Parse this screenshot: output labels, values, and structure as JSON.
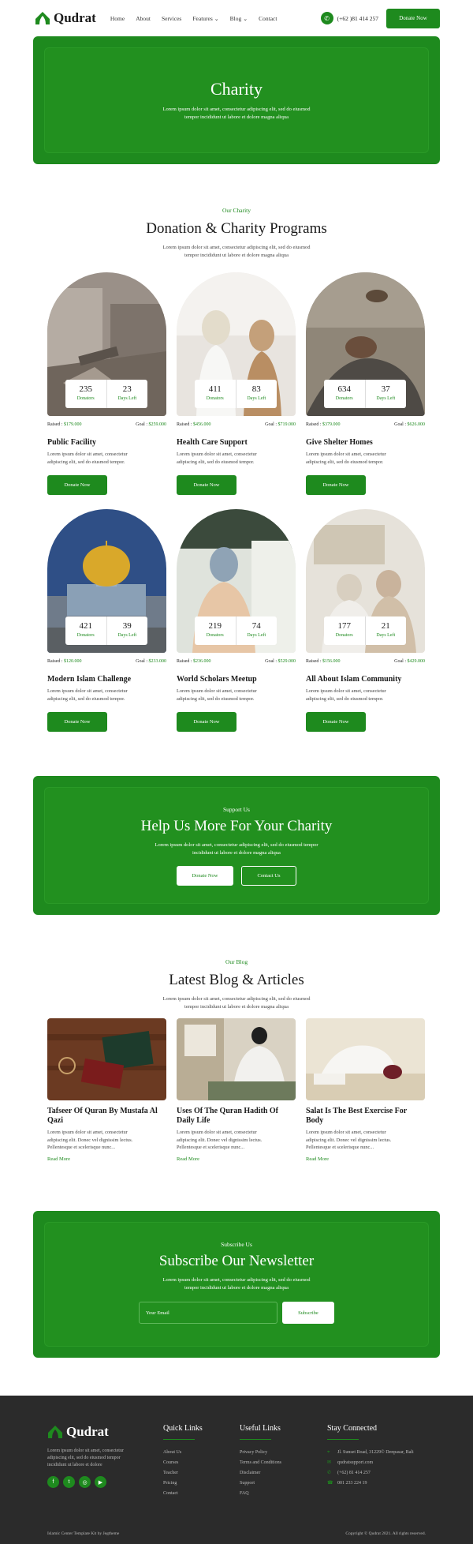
{
  "nav": {
    "logo": "Qudrat",
    "menu": [
      {
        "label": "Home",
        "active": false
      },
      {
        "label": "About",
        "active": false
      },
      {
        "label": "Services",
        "active": false
      },
      {
        "label": "Features",
        "active": true,
        "dropdown": true
      },
      {
        "label": "Blog",
        "active": false,
        "dropdown": true
      },
      {
        "label": "Contact",
        "active": false
      }
    ],
    "phone": "(+62 )81 414 257",
    "donate_label": "Donate Now"
  },
  "hero": {
    "title": "Charity",
    "subtitle_1": "Lorem ipsum dolor sit amet, consectetur adipiscing elit, sed do eiusmod",
    "subtitle_2": "tempor incididunt ut labore et dolore magna aliqua"
  },
  "programs": {
    "eyebrow": "Our Charity",
    "title": "Donation & Charity Programs",
    "sub_1": "Lorem ipsum dolor sit amet, consectetur adipiscing elit, sed do eiusmod",
    "sub_2": "tempor incididunt ut labore et dolore magna aliqua",
    "donators_label": "Donators",
    "days_label": "Days Left",
    "raised_label": "Raised :",
    "goal_label": "Goal :",
    "desc_1": "Lorem ipsum dolor sit amet, consectetur",
    "desc_2": "adipiscing elit, sed do eiusmod tempor.",
    "button_label": "Donate Now",
    "items": [
      {
        "title": "Public Facility",
        "donators": "235",
        "days": "23",
        "raised": "$179.000",
        "goal": "$259.000"
      },
      {
        "title": "Health Care Support",
        "donators": "411",
        "days": "83",
        "raised": "$456.000",
        "goal": "$719.000"
      },
      {
        "title": "Give Shelter Homes",
        "donators": "634",
        "days": "37",
        "raised": "$379.000",
        "goal": "$626.000"
      },
      {
        "title": "Modern Islam Challenge",
        "donators": "421",
        "days": "39",
        "raised": "$120.000",
        "goal": "$233.000"
      },
      {
        "title": "World Scholars Meetup",
        "donators": "219",
        "days": "74",
        "raised": "$236.000",
        "goal": "$529.000"
      },
      {
        "title": "All About Islam Community",
        "donators": "177",
        "days": "21",
        "raised": "$156.000",
        "goal": "$429.000"
      }
    ]
  },
  "support": {
    "eyebrow": "Support Us",
    "title": "Help Us More For Your Charity",
    "sub_1": "Lorem ipsum dolor sit amet, consectetur adipiscing elit, sed do eiusmod tempor",
    "sub_2": "incididunt ut labore et dolore magna aliqua",
    "donate_label": "Donate Now",
    "contact_label": "Contact Us"
  },
  "blog": {
    "eyebrow": "Our Blog",
    "title": "Latest Blog & Articles",
    "sub_1": "Lorem ipsum dolor sit amet, consectetur adipiscing elit, sed do eiusmod",
    "sub_2": "tempor incididunt ut labore et dolore magna aliqua",
    "desc_1": "Lorem ipsum dolor sit amet, consectetur",
    "desc_2": "adipiscing elit. Donec vel dignissim lectus.",
    "desc_3": "Pellentesque et scelerisque nunc...",
    "read_more": "Read More",
    "posts": [
      {
        "title_1": "Tafseer Of Quran By Mustafa Al",
        "title_2": "Qazi"
      },
      {
        "title_1": "Uses Of The Quran Hadith Of",
        "title_2": "Daily Life"
      },
      {
        "title_1": "Salat Is The Best Exercise For",
        "title_2": "Body"
      }
    ]
  },
  "newsletter": {
    "eyebrow": "Subscribe Us",
    "title": "Subscribe Our Newsletter",
    "sub_1": "Lorem ipsum dolor sit amet, consectetur adipiscing elit, sed do eiusmod",
    "sub_2": "tempor incididunt ut labore et dolore magna aliqua",
    "email_placeholder": "Your Email",
    "button_label": "Subscribe"
  },
  "footer": {
    "logo": "Qudrat",
    "about_1": "Lorem ipsum dolor sit amet, consectetur",
    "about_2": "adipiscing elit, sed do eiusmod tempor",
    "about_3": "incididunt ut labore et dolore",
    "quick_links_title": "Quick Links",
    "quick_links": [
      "About Us",
      "Courses",
      "Teacher",
      "Pricing",
      "Contact"
    ],
    "useful_links_title": "Useful Links",
    "useful_links": [
      "Privacy Policy",
      "Terms and Conditions",
      "Disclaimer",
      "Support",
      "FAQ"
    ],
    "connected_title": "Stay Connected",
    "address": "Jl. Sunset Road, 31229© Denpasar, Bali",
    "email": "qudratsupport.com",
    "phone": "(+62) 81 414 257",
    "fax": "001 233 224 19",
    "credit": "Islamic Center Template Kit by Jegtheme",
    "copyright": "Copyright © Qudrat 2021. All rights reserved."
  },
  "colors": {
    "brand_green": "#1e8a1e",
    "footer_bg": "#2b2b2b"
  }
}
